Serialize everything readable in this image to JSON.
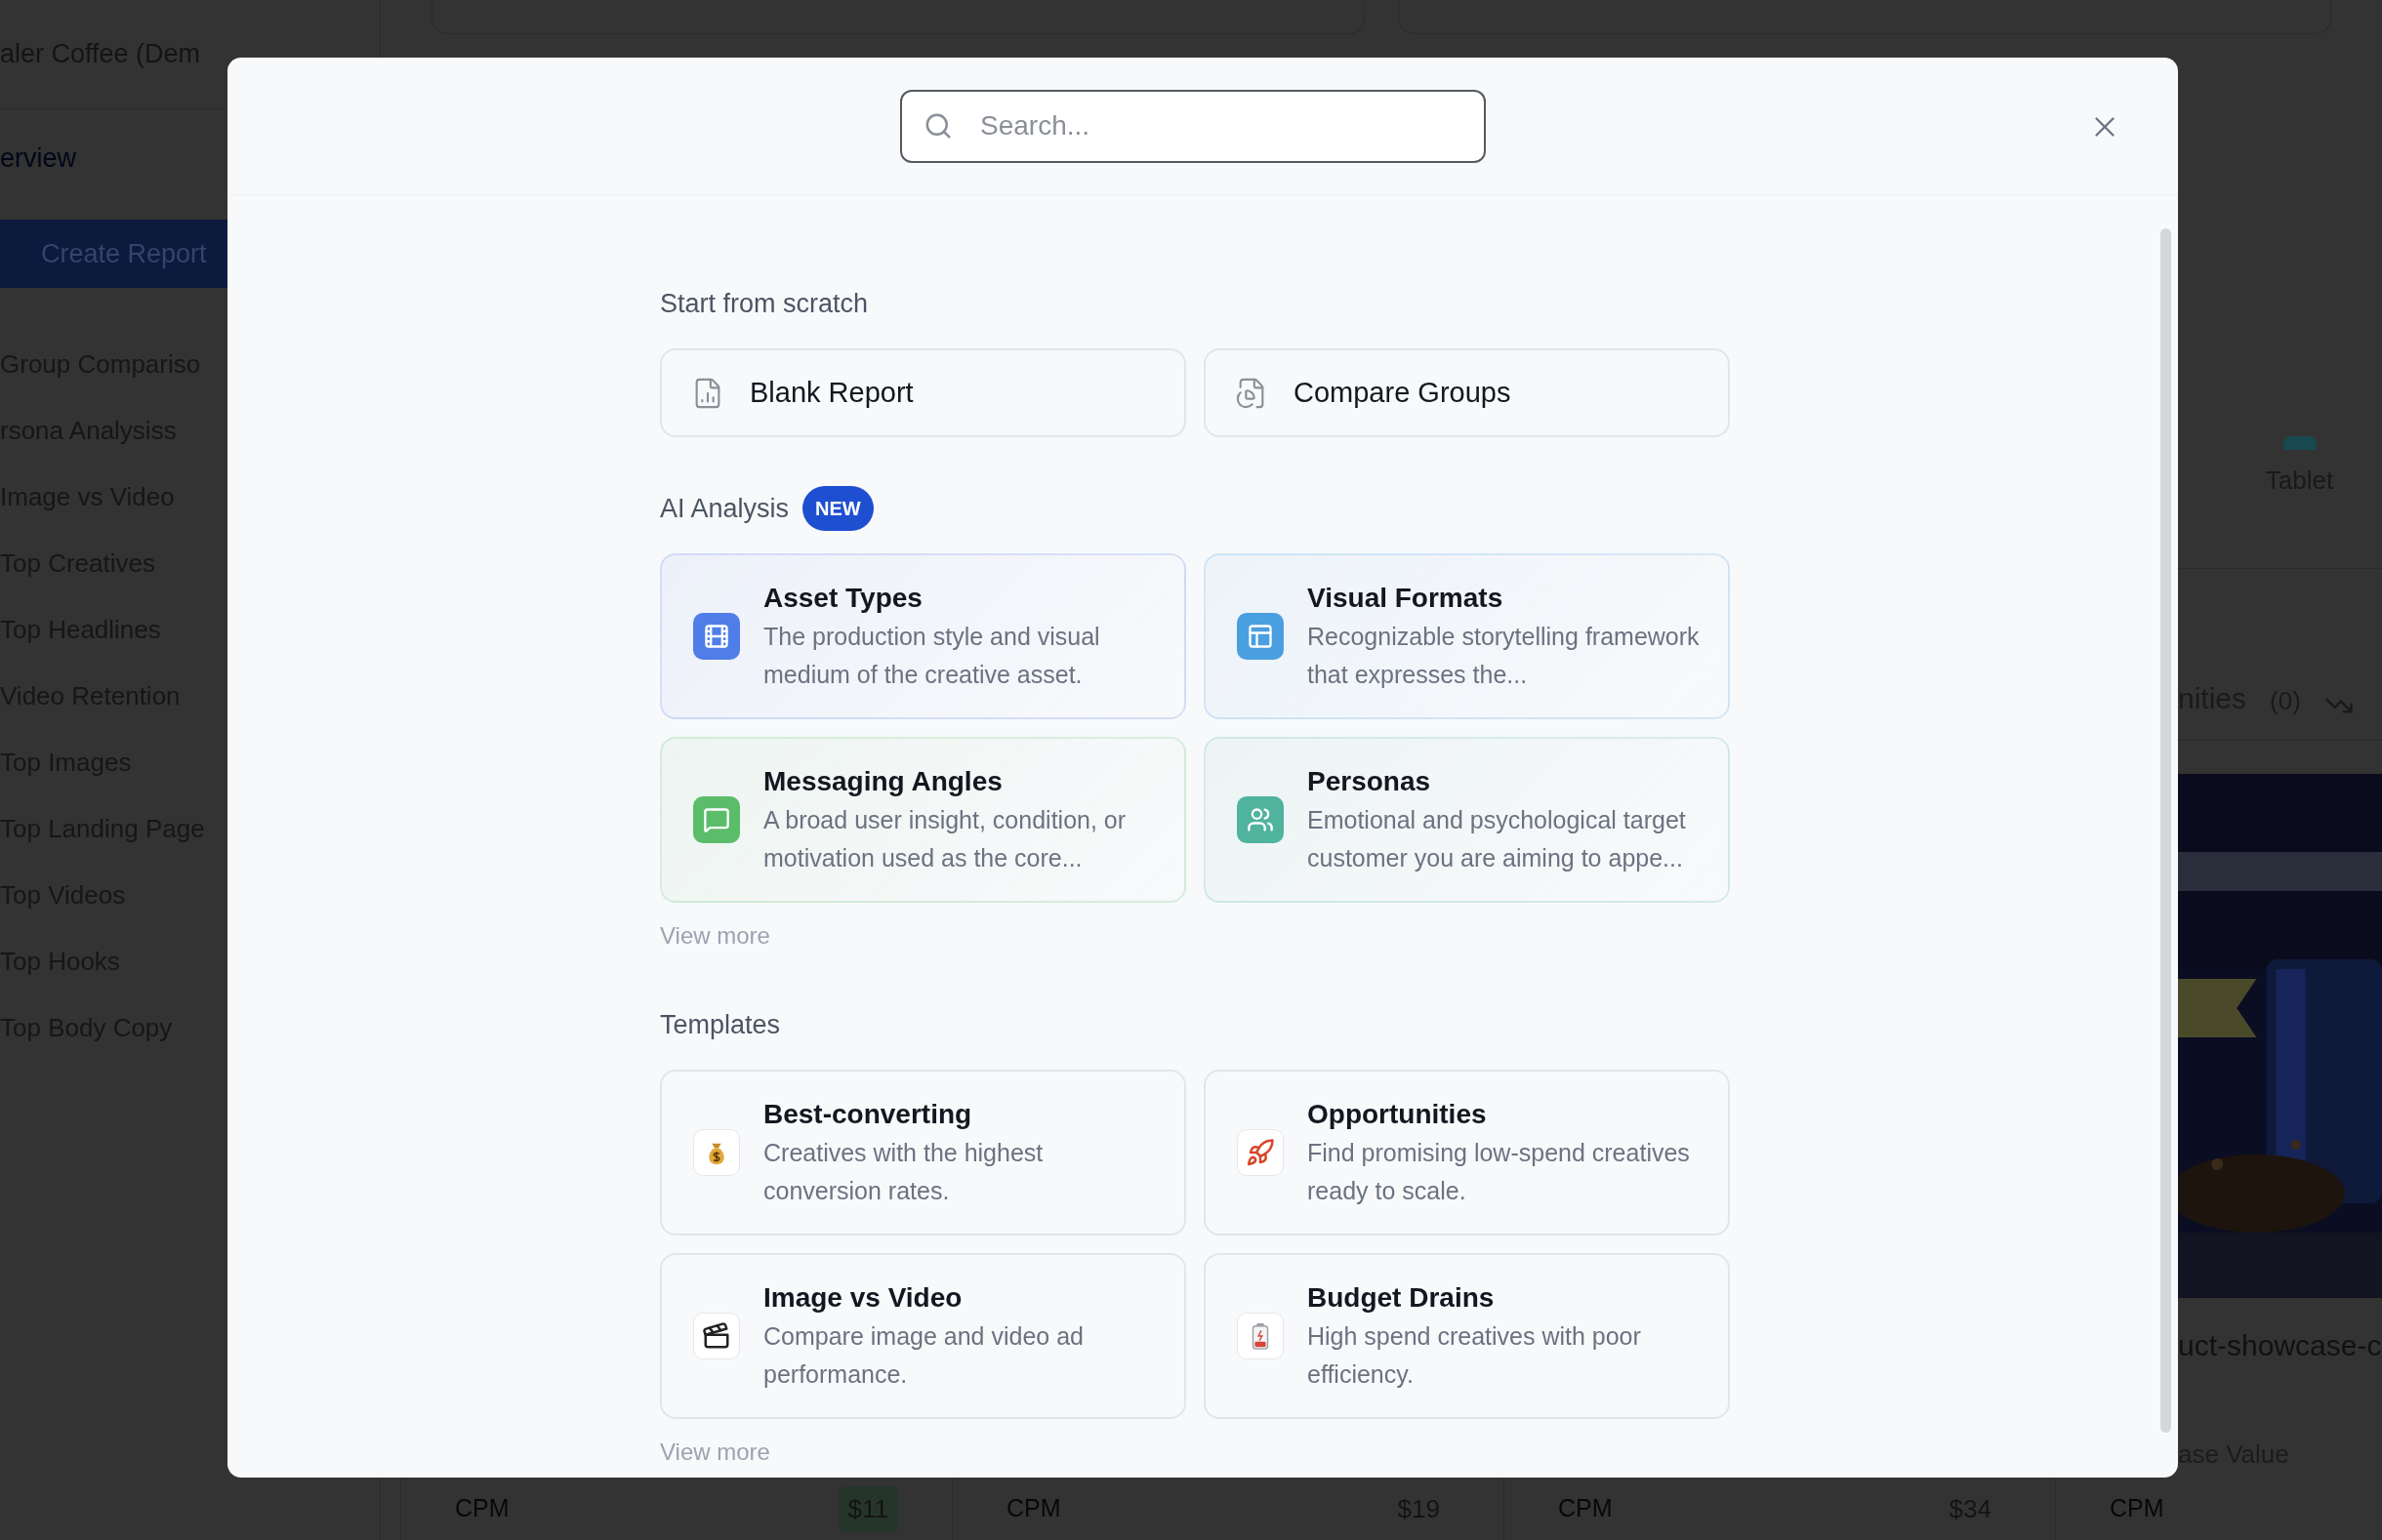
{
  "background": {
    "sidebar": {
      "title": "aler Coffee (Dem",
      "link": "erview",
      "button": "Create Report",
      "items": [
        {
          "label": "Group Compariso"
        },
        {
          "label": "rsona Analysiss"
        },
        {
          "label": "Image vs Video"
        },
        {
          "label": "Top Creatives"
        },
        {
          "label": "Top Headlines"
        },
        {
          "label": "Video Retention"
        },
        {
          "label": "Top Images"
        },
        {
          "label": "Top Landing Page"
        },
        {
          "label": "Top Videos"
        },
        {
          "label": "Top Hooks"
        },
        {
          "label": "Top Body Copy"
        }
      ]
    },
    "right_panel": {
      "device_label": "Tablet",
      "tab_label": "nities",
      "tab_count": "(0)",
      "caption": "uct-showcase-c",
      "metric_label": "ase Value"
    },
    "metrics_row": [
      {
        "label": "CPM",
        "value": "$11",
        "highlighted": true
      },
      {
        "label": "CPM",
        "value": "$19",
        "highlighted": false
      },
      {
        "label": "CPM",
        "value": "$34",
        "highlighted": false
      },
      {
        "label": "CPM"
      }
    ]
  },
  "modal": {
    "search": {
      "placeholder": "Search..."
    },
    "sections": [
      {
        "kind": "plain",
        "title": "Start from scratch",
        "items": [
          {
            "title": "Blank Report"
          },
          {
            "title": "Compare Groups"
          }
        ]
      },
      {
        "kind": "rich",
        "title": "AI Analysis",
        "badge": "NEW",
        "items": [
          {
            "title": "Asset Types",
            "description": "The production style and visual medium of the creative asset.",
            "color": "#4f7ee8"
          },
          {
            "title": "Visual Formats",
            "description": "Recognizable storytelling framework that expresses the...",
            "color": "#4a9fe0"
          },
          {
            "title": "Messaging Angles",
            "description": "A broad user insight, condition, or motivation used as the core...",
            "color": "#5bbd6a"
          },
          {
            "title": "Personas",
            "description": "Emotional and psychological target customer you are aiming to appe...",
            "color": "#4fb39e"
          }
        ],
        "more": "View more"
      },
      {
        "kind": "template",
        "title": "Templates",
        "items": [
          {
            "title": "Best-converting",
            "description": "Creatives with the highest conversion rates."
          },
          {
            "title": "Opportunities",
            "description": "Find promising low-spend creatives ready to scale."
          },
          {
            "title": "Image vs Video",
            "description": "Compare image and video ad performance."
          },
          {
            "title": "Budget Drains",
            "description": "High spend creatives with poor efficiency."
          }
        ],
        "more": "View more"
      }
    ]
  }
}
